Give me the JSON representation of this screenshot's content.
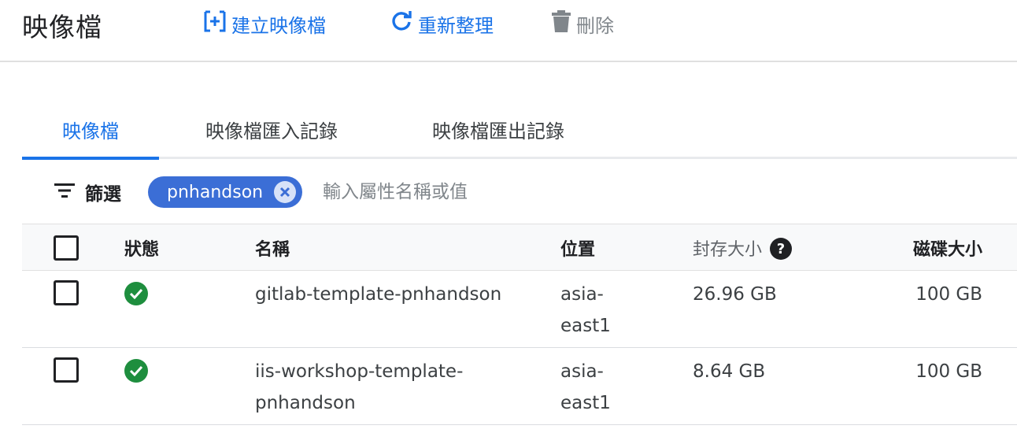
{
  "header": {
    "title": "映像檔",
    "create_label": "建立映像檔",
    "refresh_label": "重新整理",
    "delete_label": "刪除"
  },
  "tabs": [
    {
      "label": "映像檔",
      "active": true
    },
    {
      "label": "映像檔匯入記錄",
      "active": false
    },
    {
      "label": "映像檔匯出記錄",
      "active": false
    }
  ],
  "filter": {
    "label": "篩選",
    "chip": "pnhandson",
    "placeholder": "輸入屬性名稱或值"
  },
  "table": {
    "headers": {
      "status": "狀態",
      "name": "名稱",
      "location": "位置",
      "archive_size": "封存大小",
      "disk_size": "磁碟大小"
    },
    "help_icon": "?",
    "rows": [
      {
        "status": "ok",
        "name": "gitlab-template-pnhandson",
        "location": "asia-east1",
        "location_line1": "asia-",
        "location_line2": "east1",
        "archive_size": "26.96 GB",
        "disk_size": "100 GB"
      },
      {
        "status": "ok",
        "name": "iis-workshop-template-pnhandson",
        "name_line1": "iis-workshop-template-",
        "name_line2": "pnhandson",
        "location": "asia-east1",
        "location_line1": "asia-",
        "location_line2": "east1",
        "archive_size": "8.64 GB",
        "disk_size": "100 GB"
      }
    ]
  },
  "colors": {
    "accent": "#1a73e8",
    "chip": "#3b6ed6",
    "status_ok": "#1e8e3e",
    "muted": "#80868b"
  },
  "icons": {
    "create": "add-box-icon",
    "refresh": "refresh-icon",
    "delete": "trash-icon",
    "filter": "filter-list-icon",
    "chip_remove": "close-circle-icon",
    "status": "check-circle-icon",
    "help": "help-circle-icon"
  }
}
